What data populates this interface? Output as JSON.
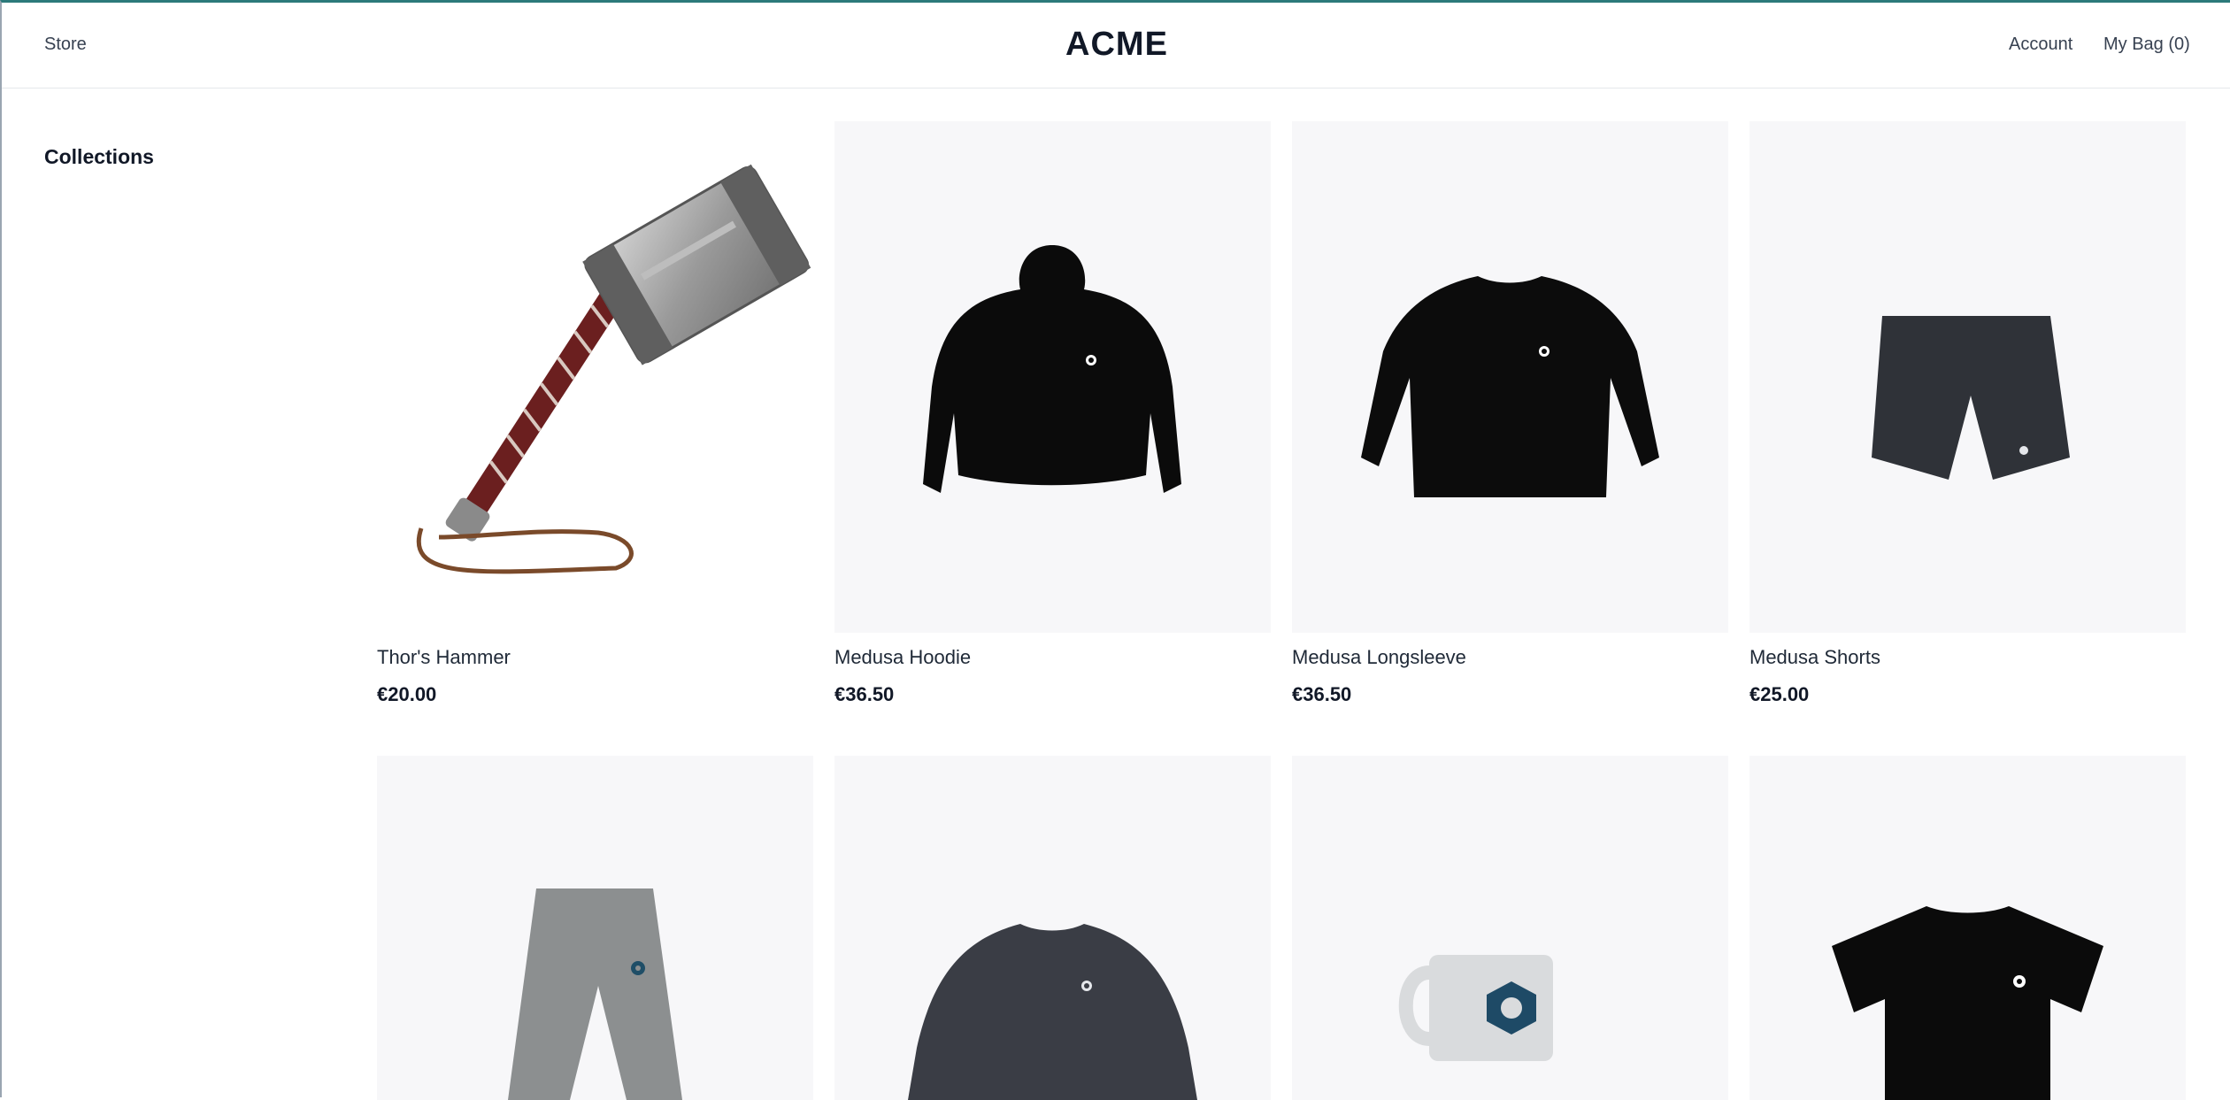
{
  "header": {
    "store_label": "Store",
    "logo": "ACME",
    "account_label": "Account",
    "bag_label": "My Bag (0)"
  },
  "sidebar": {
    "title": "Collections"
  },
  "products": [
    {
      "title": "Thor's Hammer",
      "price": "€20.00",
      "icon": "hammer-image"
    },
    {
      "title": "Medusa Hoodie",
      "price": "€36.50",
      "icon": "hoodie-image"
    },
    {
      "title": "Medusa Longsleeve",
      "price": "€36.50",
      "icon": "longsleeve-image"
    },
    {
      "title": "Medusa Shorts",
      "price": "€25.00",
      "icon": "shorts-image"
    },
    {
      "icon": "sweatpants-image"
    },
    {
      "icon": "sweatshirt-image"
    },
    {
      "icon": "mug-image"
    },
    {
      "icon": "tshirt-image"
    }
  ]
}
